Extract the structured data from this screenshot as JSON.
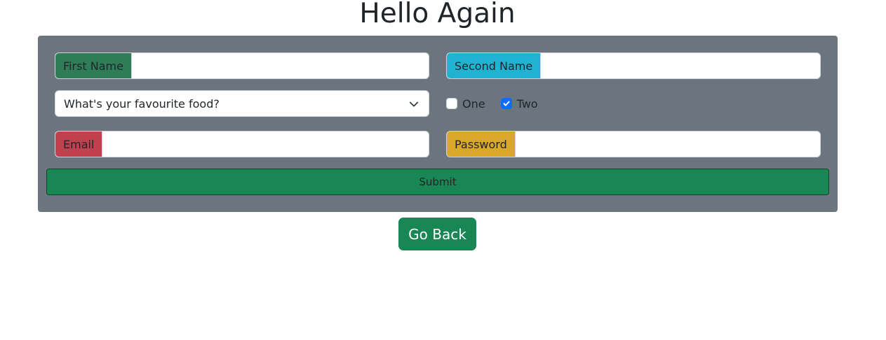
{
  "page": {
    "title": "Hello Again"
  },
  "form": {
    "first_name": {
      "label": "First Name",
      "value": "",
      "color": "#2e7d57"
    },
    "second_name": {
      "label": "Second Name",
      "value": "",
      "color": "#1fb3d1"
    },
    "food_select": {
      "selected": "What's your favourite food?"
    },
    "checkboxes": [
      {
        "label": "One",
        "checked": false
      },
      {
        "label": "Two",
        "checked": true
      }
    ],
    "email": {
      "label": "Email",
      "value": "",
      "color": "#c0404f"
    },
    "password": {
      "label": "Password",
      "value": "",
      "color": "#d9a72a"
    },
    "submit_label": "Submit"
  },
  "footer": {
    "go_back_label": "Go Back"
  },
  "colors": {
    "panel": "#6c757d",
    "success": "#198754",
    "checkbox_checked": "#0d6efd"
  }
}
